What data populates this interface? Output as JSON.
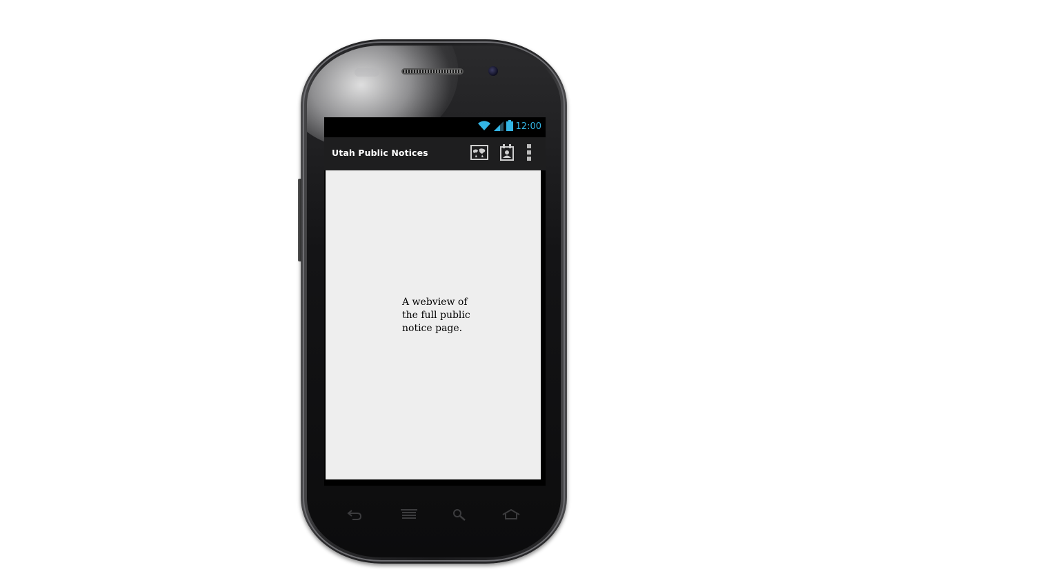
{
  "device": {
    "softkeys": [
      {
        "icon": "back-icon"
      },
      {
        "icon": "menu-icon"
      },
      {
        "icon": "search-icon"
      },
      {
        "icon": "home-icon"
      }
    ]
  },
  "status_bar": {
    "time": "12:00",
    "icons": [
      "wifi-icon",
      "signal-icon",
      "battery-icon"
    ],
    "accent_color": "#33b5e5"
  },
  "action_bar": {
    "title": "Utah Public Notices",
    "actions": [
      {
        "icon": "map-icon"
      },
      {
        "icon": "calendar-contact-icon"
      },
      {
        "icon": "overflow-menu-icon"
      }
    ],
    "background_color": "#1e1e1f"
  },
  "content": {
    "text": "A webview of the full public notice page.",
    "background_color": "#eeeeee"
  }
}
